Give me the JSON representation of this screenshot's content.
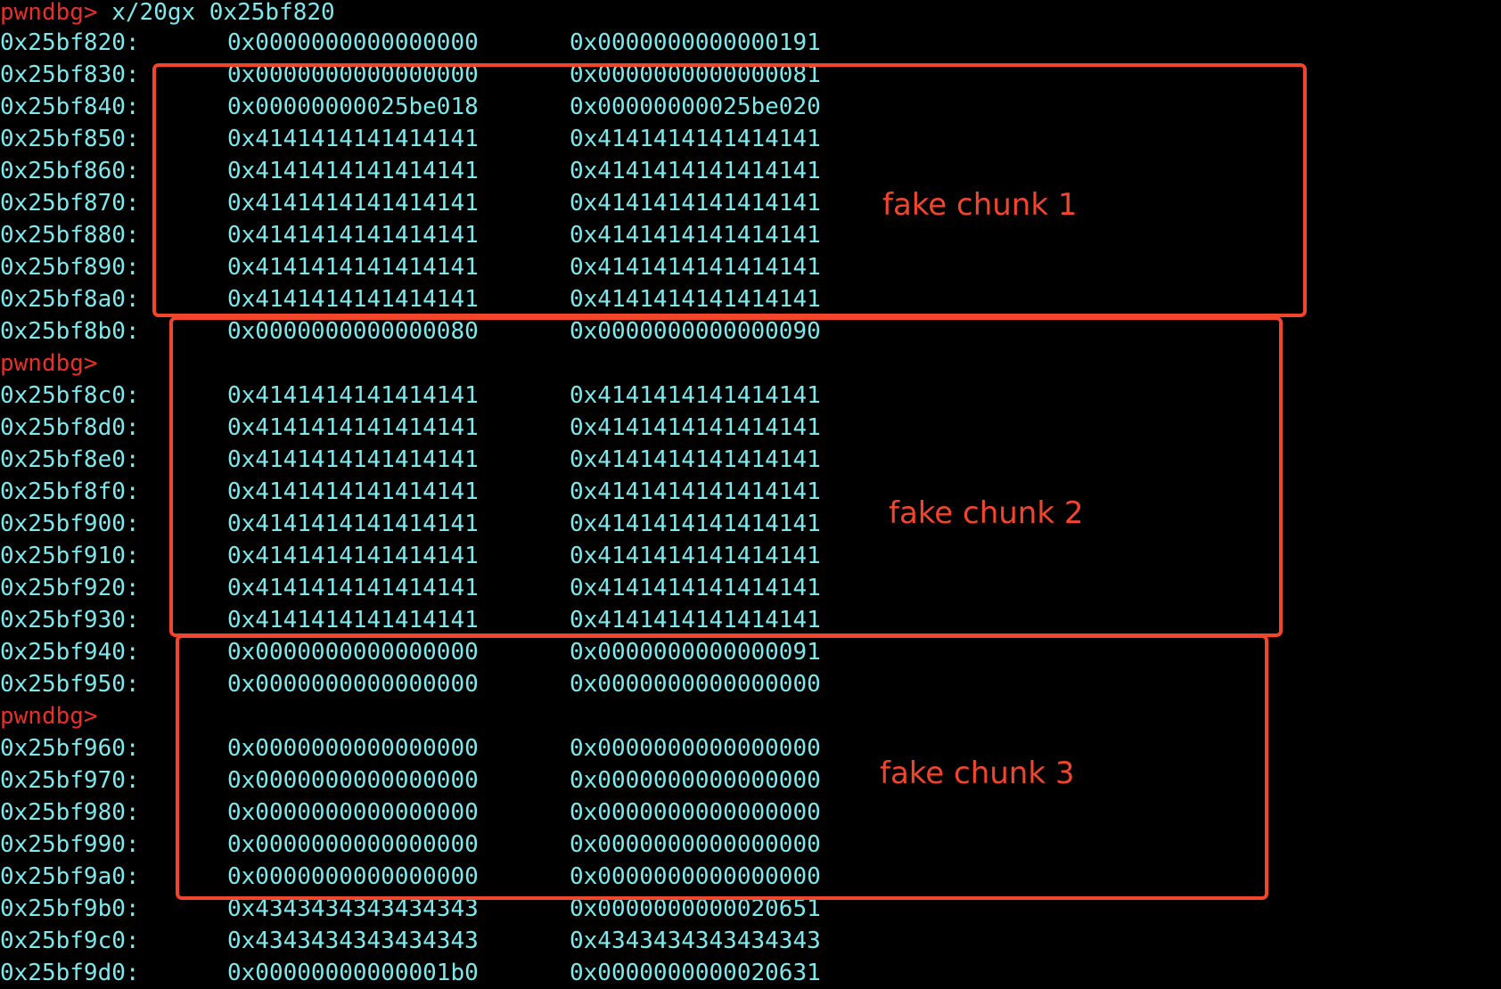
{
  "terminal": {
    "prompt": "pwndbg>",
    "command": " x/20gx 0x25bf820",
    "lines": [
      {
        "kind": "row",
        "addr": "0x25bf820:",
        "v1": "0x0000000000000000",
        "v2": "0x0000000000000191"
      },
      {
        "kind": "row",
        "addr": "0x25bf830:",
        "v1": "0x0000000000000000",
        "v2": "0x0000000000000081"
      },
      {
        "kind": "row",
        "addr": "0x25bf840:",
        "v1": "0x00000000025be018",
        "v2": "0x00000000025be020"
      },
      {
        "kind": "row",
        "addr": "0x25bf850:",
        "v1": "0x4141414141414141",
        "v2": "0x4141414141414141"
      },
      {
        "kind": "row",
        "addr": "0x25bf860:",
        "v1": "0x4141414141414141",
        "v2": "0x4141414141414141"
      },
      {
        "kind": "row",
        "addr": "0x25bf870:",
        "v1": "0x4141414141414141",
        "v2": "0x4141414141414141"
      },
      {
        "kind": "row",
        "addr": "0x25bf880:",
        "v1": "0x4141414141414141",
        "v2": "0x4141414141414141"
      },
      {
        "kind": "row",
        "addr": "0x25bf890:",
        "v1": "0x4141414141414141",
        "v2": "0x4141414141414141"
      },
      {
        "kind": "row",
        "addr": "0x25bf8a0:",
        "v1": "0x4141414141414141",
        "v2": "0x4141414141414141"
      },
      {
        "kind": "row",
        "addr": "0x25bf8b0:",
        "v1": "0x0000000000000080",
        "v2": "0x0000000000000090"
      },
      {
        "kind": "prompt",
        "text": "pwndbg>"
      },
      {
        "kind": "row",
        "addr": "0x25bf8c0:",
        "v1": "0x4141414141414141",
        "v2": "0x4141414141414141"
      },
      {
        "kind": "row",
        "addr": "0x25bf8d0:",
        "v1": "0x4141414141414141",
        "v2": "0x4141414141414141"
      },
      {
        "kind": "row",
        "addr": "0x25bf8e0:",
        "v1": "0x4141414141414141",
        "v2": "0x4141414141414141"
      },
      {
        "kind": "row",
        "addr": "0x25bf8f0:",
        "v1": "0x4141414141414141",
        "v2": "0x4141414141414141"
      },
      {
        "kind": "row",
        "addr": "0x25bf900:",
        "v1": "0x4141414141414141",
        "v2": "0x4141414141414141"
      },
      {
        "kind": "row",
        "addr": "0x25bf910:",
        "v1": "0x4141414141414141",
        "v2": "0x4141414141414141"
      },
      {
        "kind": "row",
        "addr": "0x25bf920:",
        "v1": "0x4141414141414141",
        "v2": "0x4141414141414141"
      },
      {
        "kind": "row",
        "addr": "0x25bf930:",
        "v1": "0x4141414141414141",
        "v2": "0x4141414141414141"
      },
      {
        "kind": "row",
        "addr": "0x25bf940:",
        "v1": "0x0000000000000000",
        "v2": "0x0000000000000091"
      },
      {
        "kind": "row",
        "addr": "0x25bf950:",
        "v1": "0x0000000000000000",
        "v2": "0x0000000000000000"
      },
      {
        "kind": "prompt",
        "text": "pwndbg>"
      },
      {
        "kind": "row",
        "addr": "0x25bf960:",
        "v1": "0x0000000000000000",
        "v2": "0x0000000000000000"
      },
      {
        "kind": "row",
        "addr": "0x25bf970:",
        "v1": "0x0000000000000000",
        "v2": "0x0000000000000000"
      },
      {
        "kind": "row",
        "addr": "0x25bf980:",
        "v1": "0x0000000000000000",
        "v2": "0x0000000000000000"
      },
      {
        "kind": "row",
        "addr": "0x25bf990:",
        "v1": "0x0000000000000000",
        "v2": "0x0000000000000000"
      },
      {
        "kind": "row",
        "addr": "0x25bf9a0:",
        "v1": "0x0000000000000000",
        "v2": "0x0000000000000000"
      },
      {
        "kind": "row",
        "addr": "0x25bf9b0:",
        "v1": "0x4343434343434343",
        "v2": "0x0000000000020651"
      },
      {
        "kind": "row",
        "addr": "0x25bf9c0:",
        "v1": "0x4343434343434343",
        "v2": "0x4343434343434343"
      },
      {
        "kind": "row",
        "addr": "0x25bf9d0:",
        "v1": "0x00000000000001b0",
        "v2": "0x0000000000020631"
      }
    ]
  },
  "annotations": [
    {
      "label": "fake chunk 1"
    },
    {
      "label": "fake chunk 2"
    },
    {
      "label": "fake chunk 3"
    }
  ],
  "colors": {
    "background": "#000000",
    "text": "#7ee8ec",
    "prompt": "#e8302a",
    "annotation": "#f2452c"
  }
}
